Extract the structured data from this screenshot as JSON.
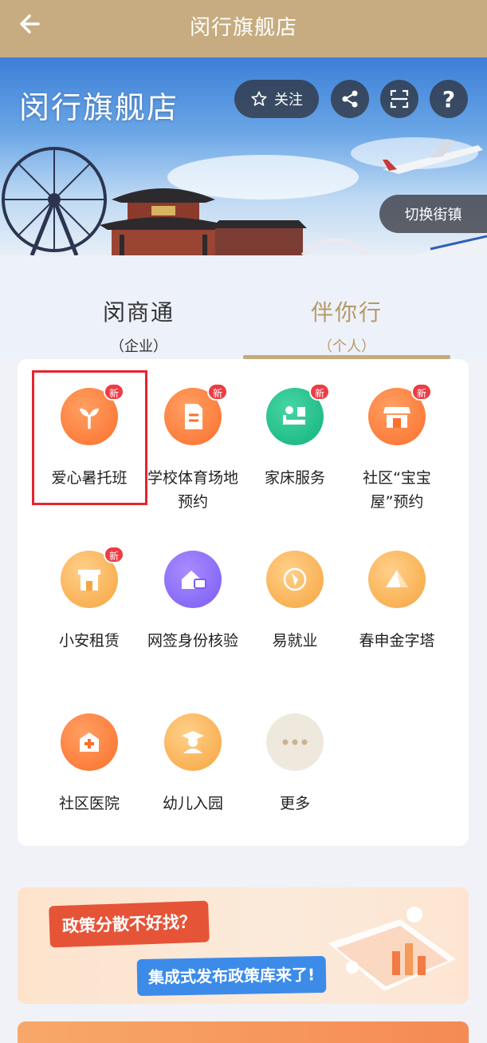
{
  "topbar": {
    "title": "闵行旗舰店"
  },
  "hero": {
    "title": "闵行旗舰店",
    "follow_label": "关注",
    "help_label": "?",
    "switch_label": "切换街镇"
  },
  "tabs": [
    {
      "label": "闵商通",
      "sub": "（企业）"
    },
    {
      "label": "伴你行",
      "sub": "（个人）"
    }
  ],
  "services": [
    {
      "label": "爱心暑托班",
      "badge": "新",
      "icon": "sprout-icon"
    },
    {
      "label": "学校体育场地预约",
      "badge": "新",
      "icon": "document-icon"
    },
    {
      "label": "家床服务",
      "badge": "新",
      "icon": "bed-care-icon"
    },
    {
      "label": "社区“宝宝屋”预约",
      "badge": "新",
      "icon": "store-icon"
    },
    {
      "label": "小安租赁",
      "badge": "新",
      "icon": "house-icon"
    },
    {
      "label": "网签身份核验",
      "badge": "",
      "icon": "home-id-icon"
    },
    {
      "label": "易就业",
      "badge": "",
      "icon": "pen-icon"
    },
    {
      "label": "春申金字塔",
      "badge": "",
      "icon": "pyramid-icon"
    },
    {
      "label": "社区医院",
      "badge": "",
      "icon": "hospital-icon"
    },
    {
      "label": "幼儿入园",
      "badge": "",
      "icon": "graduate-icon"
    },
    {
      "label": "更多",
      "badge": "",
      "icon": "more-icon"
    }
  ],
  "banner": {
    "bubble1": "政策分散不好找？",
    "bubble2": "集成式发布政策库来了!"
  },
  "colors": {
    "brand": "#c6ac80",
    "active_tab": "#b79a66",
    "badge": "#ec3c45",
    "highlight": "#e8232d"
  }
}
